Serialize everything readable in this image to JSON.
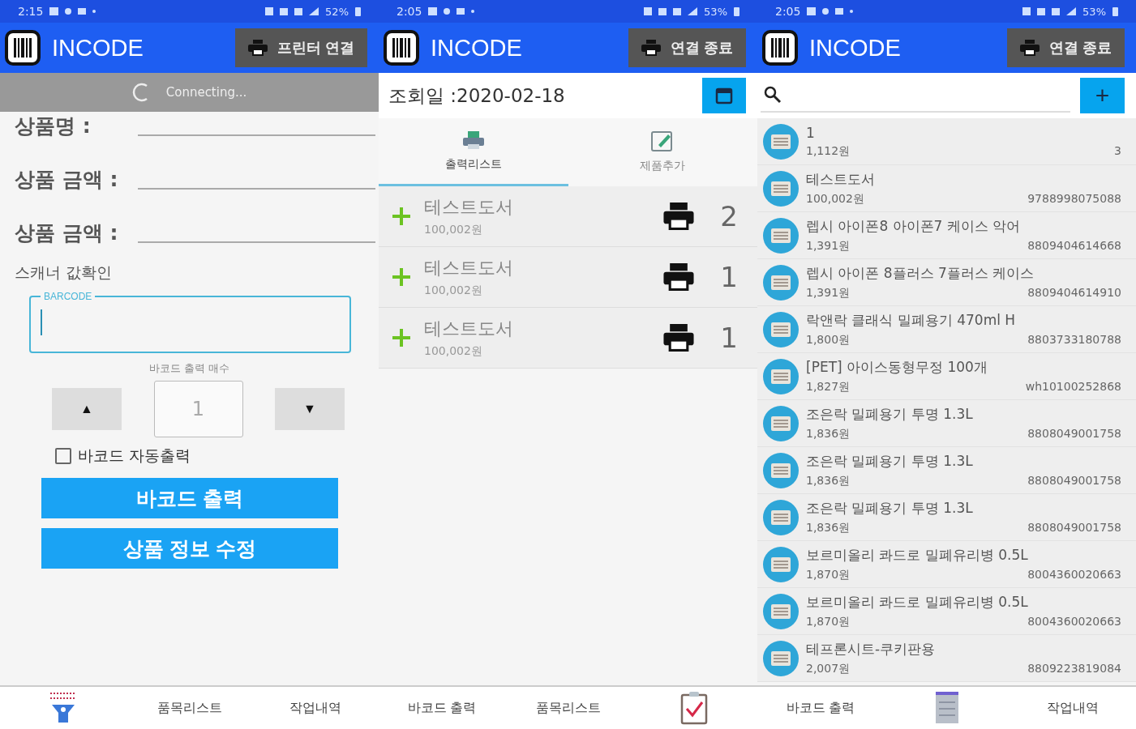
{
  "screens": [
    {
      "status_bar": {
        "time": "2:15",
        "battery": "52%"
      },
      "app_bar": {
        "title": "INCODE",
        "action": "프린터 연결"
      },
      "kind": "form",
      "loading": {
        "text": "Connecting..."
      },
      "fields": [
        {
          "label": "상품명 :"
        },
        {
          "label": "상품 금액 :"
        },
        {
          "label": "상품 금액 :"
        }
      ],
      "scanner_label": "스캐너 값확인",
      "barcode_field": {
        "label": "BARCODE"
      },
      "count_label": "바코드 출력 매수",
      "stepper": {
        "up": "▲",
        "value": "1",
        "down": "▼"
      },
      "auto_print": {
        "label": "바코드 자동출력",
        "checked": false
      },
      "buttons": [
        "바코드 출력",
        "상품 정보 수정"
      ],
      "nav": [
        {
          "selected": true
        },
        {
          "label": "품목리스트",
          "selected": false
        },
        {
          "label": "작업내역",
          "selected": false
        }
      ]
    },
    {
      "status_bar": {
        "time": "2:05",
        "battery": "53%"
      },
      "app_bar": {
        "title": "INCODE",
        "action": "연결 종료"
      },
      "kind": "history",
      "date_label": "조회일 :2020-02-18",
      "tabs": [
        {
          "label": "출력리스트",
          "selected": true
        },
        {
          "label": "제품추가",
          "selected": false
        }
      ],
      "rows": [
        {
          "name": "테스트도서",
          "price": "100,002원",
          "count": "2"
        },
        {
          "name": "테스트도서",
          "price": "100,002원",
          "count": "1"
        },
        {
          "name": "테스트도서",
          "price": "100,002원",
          "count": "1"
        }
      ],
      "nav": [
        {
          "label": "바코드 출력",
          "selected": false
        },
        {
          "label": "품목리스트",
          "selected": false
        },
        {
          "selected": true
        }
      ]
    },
    {
      "status_bar": {
        "time": "2:05",
        "battery": "53%"
      },
      "app_bar": {
        "title": "INCODE",
        "action": "연결 종료"
      },
      "kind": "products",
      "add_button": "+",
      "products": [
        {
          "name": "1",
          "price": "1,112원",
          "code": "3"
        },
        {
          "name": "테스트도서",
          "price": "100,002원",
          "code": "9788998075088"
        },
        {
          "name": "렙시 아이폰8 아이폰7 케이스 악어",
          "price": "1,391원",
          "code": "8809404614668"
        },
        {
          "name": "렙시 아이폰 8플러스 7플러스 케이스",
          "price": "1,391원",
          "code": "8809404614910"
        },
        {
          "name": "락앤락 클래식 밀폐용기 470ml H",
          "price": "1,800원",
          "code": "8803733180788"
        },
        {
          "name": "[PET] 아이스동형무정 100개",
          "price": "1,827원",
          "code": "wh10100252868"
        },
        {
          "name": "조은락 밀폐용기 투명 1.3L",
          "price": "1,836원",
          "code": "8808049001758"
        },
        {
          "name": "조은락 밀폐용기 투명 1.3L",
          "price": "1,836원",
          "code": "8808049001758"
        },
        {
          "name": "조은락 밀폐용기 투명 1.3L",
          "price": "1,836원",
          "code": "8808049001758"
        },
        {
          "name": "보르미올리 콰드로 밀폐유리병 0.5L",
          "price": "1,870원",
          "code": "8004360020663"
        },
        {
          "name": "보르미올리 콰드로 밀폐유리병 0.5L",
          "price": "1,870원",
          "code": "8004360020663"
        },
        {
          "name": "테프론시트-쿠키판용",
          "price": "2,007원",
          "code": "8809223819084"
        }
      ],
      "nav": [
        {
          "label": "바코드 출력",
          "selected": false
        },
        {
          "selected": true
        },
        {
          "label": "작업내역",
          "selected": false
        }
      ]
    }
  ]
}
